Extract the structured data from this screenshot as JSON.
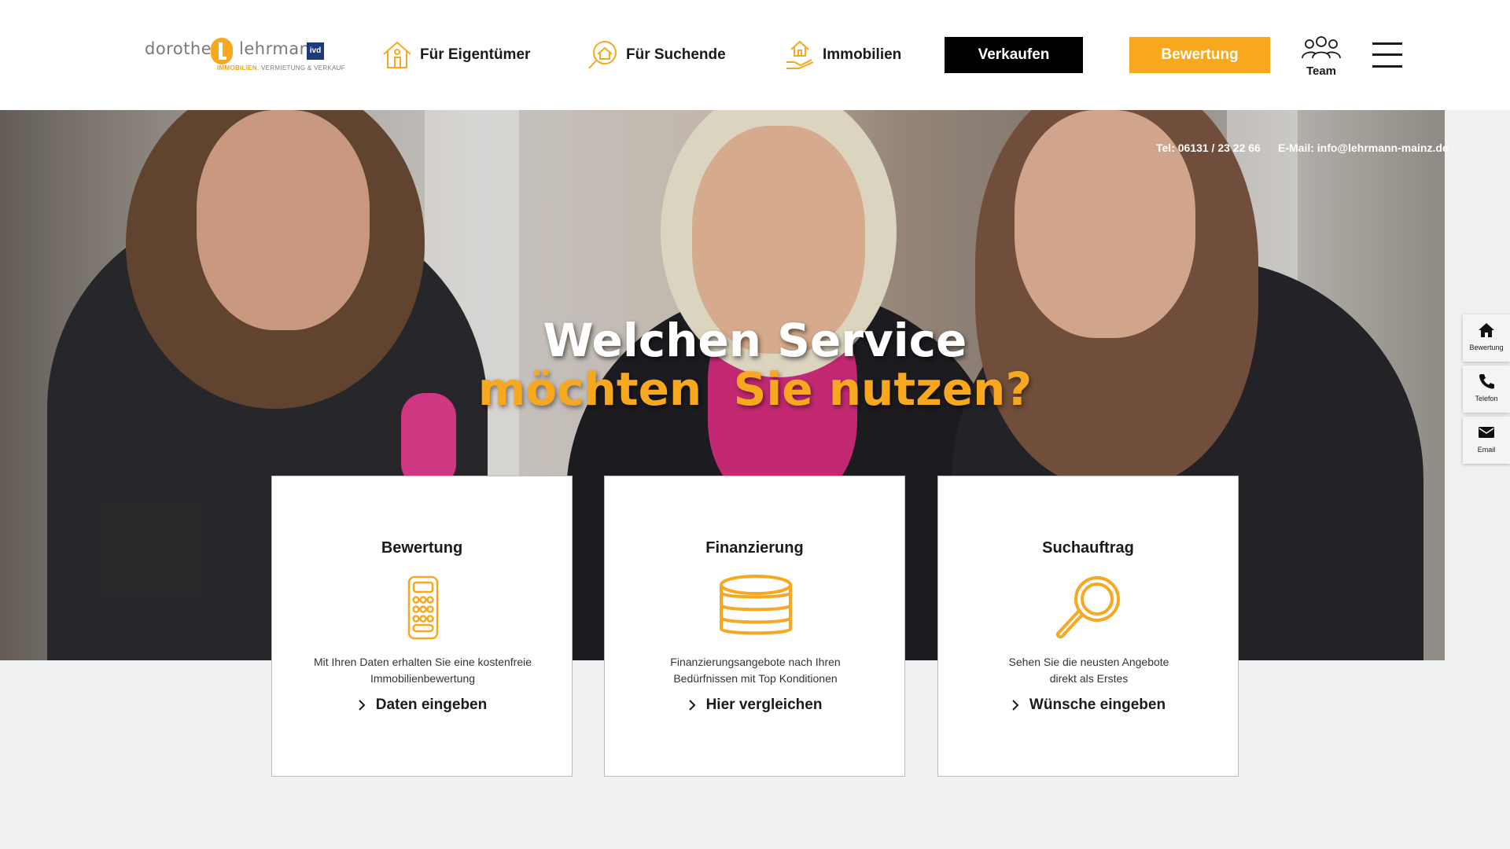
{
  "brand": {
    "name_first": "dorothea",
    "name_last": "lehrmann",
    "badge": "ivd",
    "tagline_accent": "IMMOBILIEN",
    "tagline_rest": "VERMIETUNG & VERKAUF",
    "accent_color": "#f7a81f"
  },
  "nav": {
    "owners": "Für Eigentümer",
    "seekers": "Für Suchende",
    "properties": "Immobilien",
    "sell_button": "Verkaufen",
    "valuation_button": "Bewertung",
    "team": "Team"
  },
  "contact": {
    "tel": "Tel: 06131 / 23 22 66",
    "email": "E-Mail: info@lehrmann-mainz.de"
  },
  "hero": {
    "line1": "Welchen Service",
    "line2": "möchten  Sie nutzen?"
  },
  "side_widgets": [
    {
      "label": "Bewertung",
      "icon": "home-icon"
    },
    {
      "label": "Telefon",
      "icon": "phone-icon"
    },
    {
      "label": "Email",
      "icon": "mail-icon"
    }
  ],
  "cards": [
    {
      "title": "Bewertung",
      "icon": "calculator-icon",
      "desc_line1": "Mit Ihren Daten erhalten Sie eine kostenfreie",
      "desc_line2": "Immobilienbewertung",
      "cta": "Daten eingeben"
    },
    {
      "title": "Finanzierung",
      "icon": "coins-icon",
      "desc_line1": "Finanzierungsangebote nach Ihren",
      "desc_line2": "Bedürfnissen mit Top Konditionen",
      "cta": "Hier vergleichen"
    },
    {
      "title": "Suchauftrag",
      "icon": "magnifier-icon",
      "desc_line1": "Sehen Sie die neusten Angebote",
      "desc_line2": "direkt als Erstes",
      "cta": "Wünsche eingeben"
    }
  ]
}
